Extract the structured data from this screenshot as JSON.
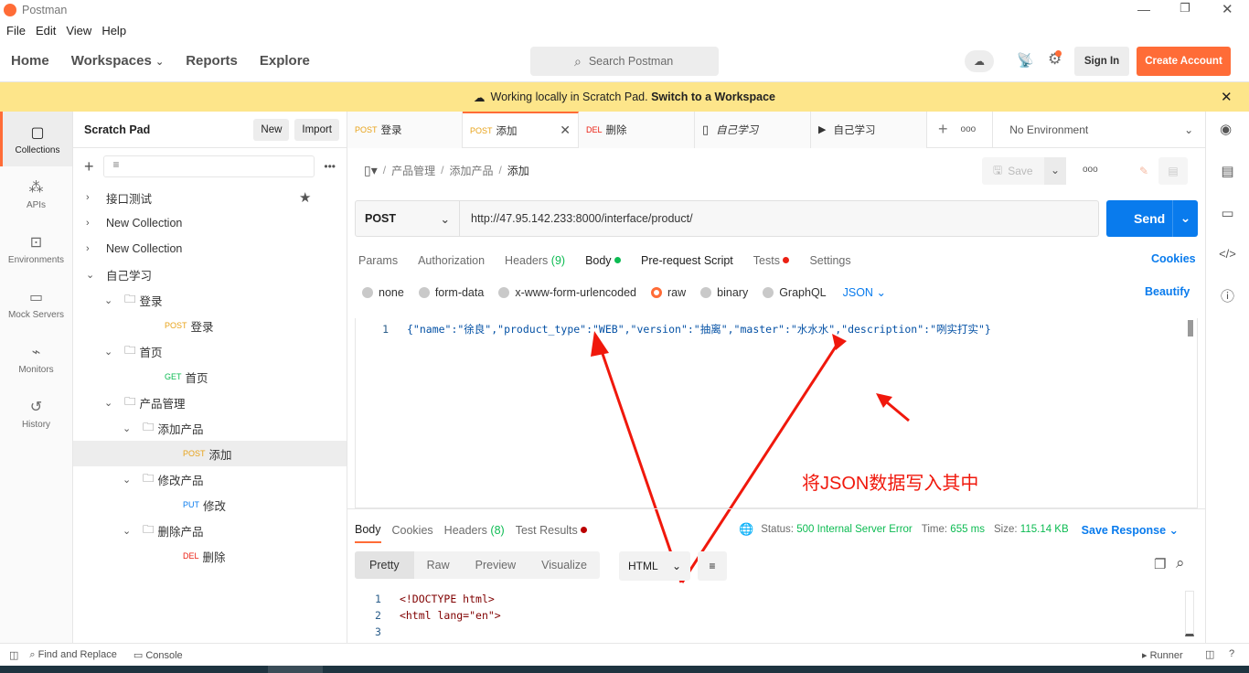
{
  "window": {
    "title": "Postman"
  },
  "menu": [
    "File",
    "Edit",
    "View",
    "Help"
  ],
  "nav": {
    "home": "Home",
    "workspaces": "Workspaces",
    "reports": "Reports",
    "explore": "Explore",
    "search_placeholder": "Search Postman",
    "sign_in": "Sign In",
    "create_account": "Create Account"
  },
  "banner": {
    "text": "Working locally in Scratch Pad.",
    "link": "Switch to a Workspace"
  },
  "rail": [
    {
      "label": "Collections"
    },
    {
      "label": "APIs"
    },
    {
      "label": "Environments"
    },
    {
      "label": "Mock Servers"
    },
    {
      "label": "Monitors"
    },
    {
      "label": "History"
    }
  ],
  "sidebar": {
    "title": "Scratch Pad",
    "new": "New",
    "import": "Import",
    "items": [
      {
        "label": "接口测试",
        "level": 0,
        "chev": "›"
      },
      {
        "label": "New Collection",
        "level": 0,
        "chev": "›"
      },
      {
        "label": "New Collection",
        "level": 0,
        "chev": "›"
      },
      {
        "label": "自己学习",
        "level": 0,
        "chev": "⌄"
      },
      {
        "label": "登录",
        "level": 1,
        "chev": "⌄",
        "folder": true
      },
      {
        "label": "登录",
        "level": 2,
        "method": "POST"
      },
      {
        "label": "首页",
        "level": 1,
        "chev": "⌄",
        "folder": true
      },
      {
        "label": "首页",
        "level": 2,
        "method": "GET"
      },
      {
        "label": "产品管理",
        "level": 1,
        "chev": "⌄",
        "folder": true
      },
      {
        "label": "添加产品",
        "level": 2,
        "chev": "⌄",
        "folder": true
      },
      {
        "label": "添加",
        "level": 3,
        "method": "POST",
        "active": true
      },
      {
        "label": "修改产品",
        "level": 2,
        "chev": "⌄",
        "folder": true
      },
      {
        "label": "修改",
        "level": 3,
        "method": "PUT"
      },
      {
        "label": "删除产品",
        "level": 2,
        "chev": "⌄",
        "folder": true
      },
      {
        "label": "删除",
        "level": 3,
        "method": "DEL"
      }
    ]
  },
  "tabs": [
    {
      "method": "POST",
      "label": "登录"
    },
    {
      "method": "POST",
      "label": "添加",
      "active": true
    },
    {
      "method": "DEL",
      "label": "删除"
    },
    {
      "label": "自己学习",
      "icon": "doc"
    },
    {
      "label": "自己学习",
      "icon": "runner"
    }
  ],
  "environment": "No Environment",
  "breadcrumb": [
    "产品管理",
    "添加产品",
    "添加"
  ],
  "save": "Save",
  "request": {
    "method": "POST",
    "url": "http://47.95.142.233:8000/interface/product/",
    "send": "Send"
  },
  "req_tabs": [
    {
      "label": "Params"
    },
    {
      "label": "Authorization"
    },
    {
      "label": "Headers",
      "count": "(9)"
    },
    {
      "label": "Body",
      "active": true
    },
    {
      "label": "Pre-request Script"
    },
    {
      "label": "Tests"
    },
    {
      "label": "Settings"
    }
  ],
  "cookies": "Cookies",
  "body_types": [
    "none",
    "form-data",
    "x-www-form-urlencoded",
    "raw",
    "binary",
    "GraphQL"
  ],
  "body_format": "JSON",
  "beautify": "Beautify",
  "editor_line": "{\"name\":\"徐良\",\"product_type\":\"WEB\",\"version\":\"抽离\",\"master\":\"水水水\",\"description\":\"咧实打实\"}",
  "annotation": "将JSON数据写入其中",
  "response": {
    "tabs": [
      "Body",
      "Cookies",
      "Headers",
      "Test Results"
    ],
    "headers_count": "(8)",
    "status_label": "Status:",
    "status": "500 Internal Server Error",
    "time_label": "Time:",
    "time": "655 ms",
    "size_label": "Size:",
    "size": "115.14 KB",
    "save_response": "Save Response",
    "views": [
      "Pretty",
      "Raw",
      "Preview",
      "Visualize"
    ],
    "format": "HTML",
    "lines": [
      "<!DOCTYPE html>",
      "<html lang=\"en\">",
      ""
    ]
  },
  "statusbar": {
    "find": "Find and Replace",
    "console": "Console",
    "runner": "Runner"
  },
  "colors": {
    "accent": "#ff6c37",
    "send": "#097bed",
    "banner": "#fde58a"
  }
}
